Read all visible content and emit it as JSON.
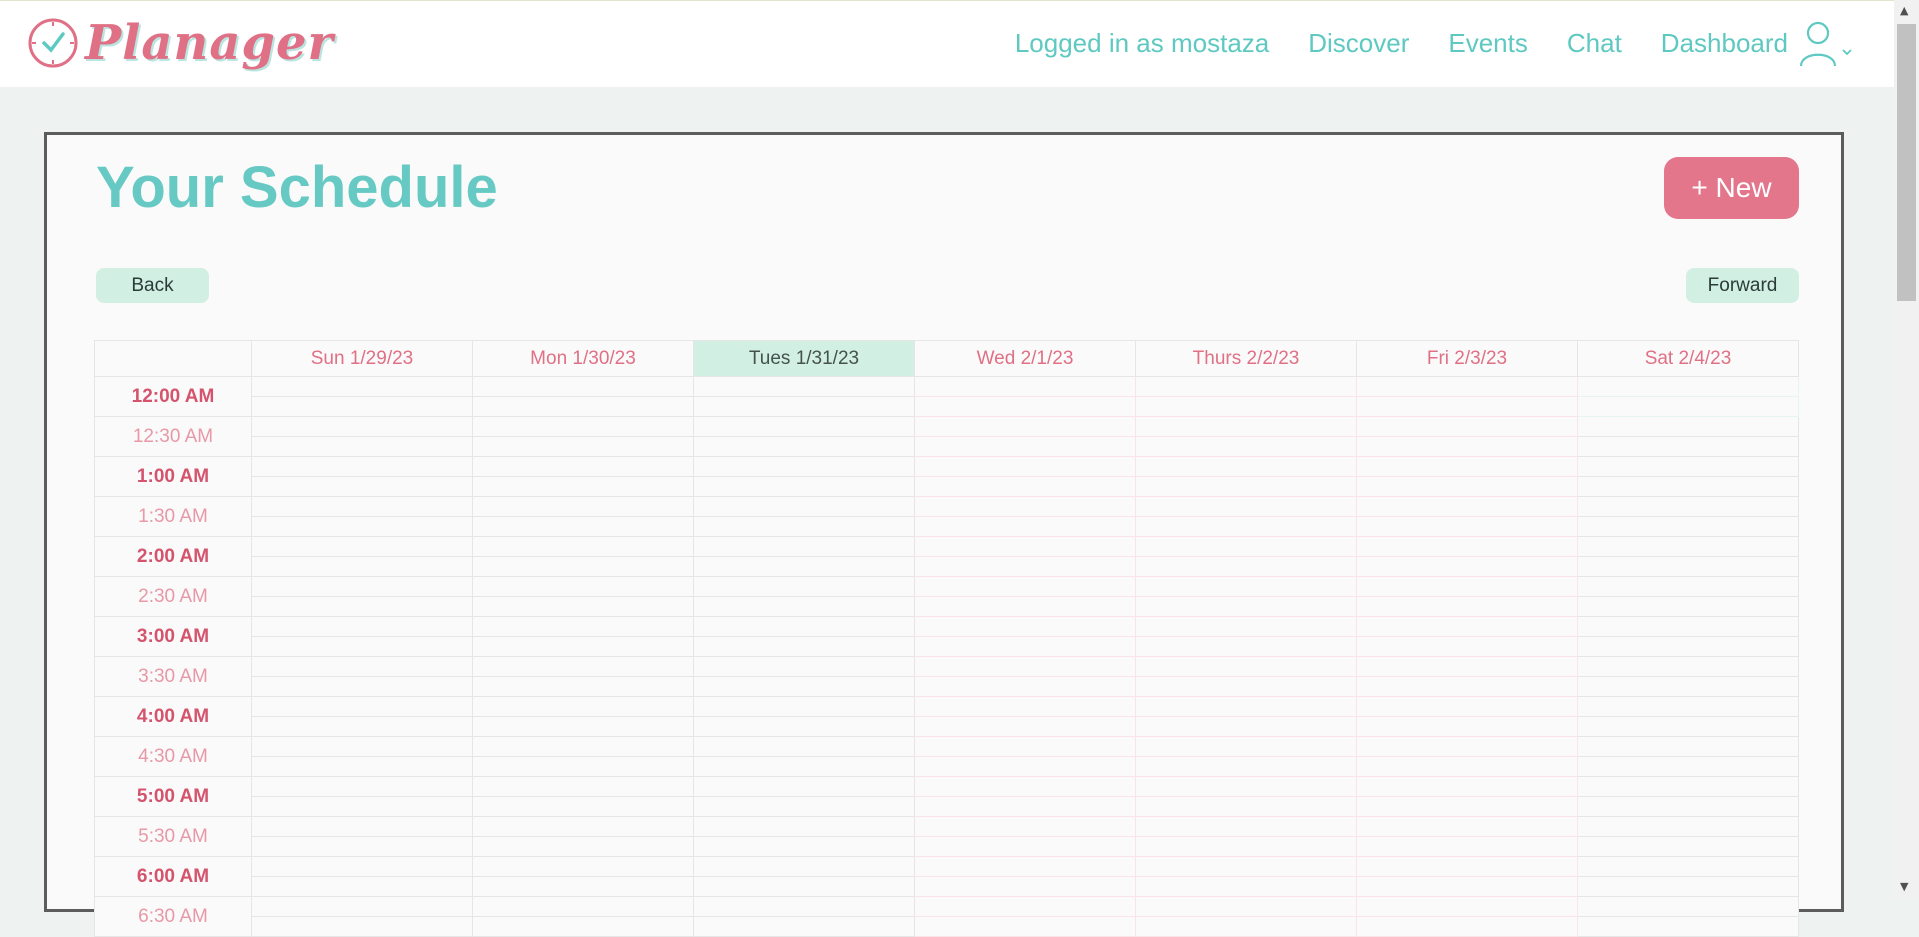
{
  "app": {
    "name": "Planager",
    "logo_icon": "clock-check-icon"
  },
  "nav": {
    "logged_in": "Logged in as mostaza",
    "links": [
      "Discover",
      "Events",
      "Chat",
      "Dashboard"
    ],
    "user_icon": "user-icon",
    "caret_icon": "chevron-down-icon"
  },
  "page": {
    "title": "Your Schedule",
    "new_button": "+ New",
    "back_button": "Back",
    "forward_button": "Forward"
  },
  "schedule": {
    "days": [
      "Sun 1/29/23",
      "Mon 1/30/23",
      "Tues 1/31/23",
      "Wed 2/1/23",
      "Thurs 2/2/23",
      "Fri 2/3/23",
      "Sat 2/4/23"
    ],
    "today_index": 2,
    "times": [
      "12:00 AM",
      "12:30 AM",
      "1:00 AM",
      "1:30 AM",
      "2:00 AM",
      "2:30 AM",
      "3:00 AM",
      "3:30 AM",
      "4:00 AM",
      "4:30 AM",
      "5:00 AM",
      "5:30 AM",
      "6:00 AM",
      "6:30 AM"
    ],
    "busy_days": [
      3,
      4,
      5
    ],
    "free_slots": [
      {
        "day": 6,
        "time_index": 0
      }
    ]
  },
  "colors": {
    "accent_teal": "#5ec9c1",
    "accent_pink": "#e3768b",
    "busy": "#f6d4da",
    "free": "#d2efe4"
  }
}
